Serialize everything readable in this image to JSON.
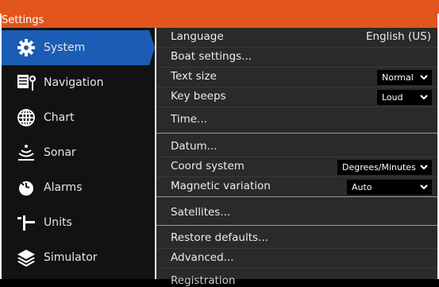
{
  "window": {
    "title": "Settings"
  },
  "colors": {
    "accent": "#e2551d",
    "selected": "#1b5cb4"
  },
  "sidebar": {
    "items": [
      {
        "label": "System",
        "icon": "gear-icon",
        "selected": true
      },
      {
        "label": "Navigation",
        "icon": "navigation-icon",
        "selected": false
      },
      {
        "label": "Chart",
        "icon": "globe-icon",
        "selected": false
      },
      {
        "label": "Sonar",
        "icon": "sonar-icon",
        "selected": false
      },
      {
        "label": "Alarms",
        "icon": "alarm-icon",
        "selected": false
      },
      {
        "label": "Units",
        "icon": "units-icon",
        "selected": false
      },
      {
        "label": "Simulator",
        "icon": "layers-icon",
        "selected": false
      }
    ]
  },
  "settings": {
    "language": {
      "label": "Language",
      "value": "English (US)"
    },
    "boat": {
      "label": "Boat settings..."
    },
    "text_size": {
      "label": "Text size",
      "value": "Normal"
    },
    "key_beeps": {
      "label": "Key beeps",
      "value": "Loud"
    },
    "time": {
      "label": "Time..."
    },
    "datum": {
      "label": "Datum..."
    },
    "coord_system": {
      "label": "Coord system",
      "value": "Degrees/Minutes"
    },
    "magnetic_variation": {
      "label": "Magnetic variation",
      "value": "Auto"
    },
    "satellites": {
      "label": "Satellites..."
    },
    "restore": {
      "label": "Restore defaults..."
    },
    "advanced": {
      "label": "Advanced..."
    },
    "registration": {
      "label": "Registration"
    }
  }
}
